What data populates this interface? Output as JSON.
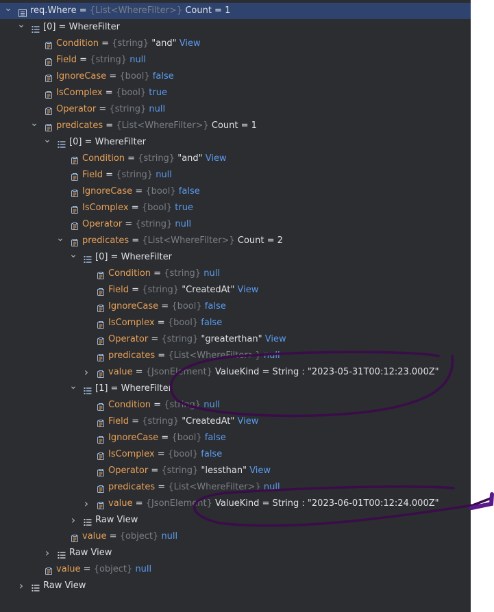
{
  "panel_bg": "#2b2d30",
  "annotation_color": "#3a0d4a",
  "rows": [
    {
      "depth": 0,
      "expander": "expanded",
      "icon": "list-icon",
      "name": "req.Where",
      "name_plain": true,
      "type": "{List<WhereFilter>}",
      "value": "Count = 1",
      "value_kind": "plain",
      "link": "",
      "selected": true
    },
    {
      "depth": 1,
      "expander": "expanded",
      "icon": "array-item-icon",
      "name": "[0]",
      "name_plain": true,
      "type": "",
      "value": "WhereFilter",
      "value_kind": "plain",
      "link": ""
    },
    {
      "depth": 2,
      "expander": "none",
      "icon": "property-icon",
      "name": "Condition",
      "type": "{string}",
      "value": "\"and\"",
      "value_kind": "str",
      "link": "View"
    },
    {
      "depth": 2,
      "expander": "none",
      "icon": "property-icon",
      "name": "Field",
      "type": "{string}",
      "value": "null",
      "value_kind": "kw",
      "link": ""
    },
    {
      "depth": 2,
      "expander": "none",
      "icon": "property-icon",
      "name": "IgnoreCase",
      "type": "{bool}",
      "value": "false",
      "value_kind": "kw",
      "link": ""
    },
    {
      "depth": 2,
      "expander": "none",
      "icon": "property-icon",
      "name": "IsComplex",
      "type": "{bool}",
      "value": "true",
      "value_kind": "kw",
      "link": ""
    },
    {
      "depth": 2,
      "expander": "none",
      "icon": "property-icon",
      "name": "Operator",
      "type": "{string}",
      "value": "null",
      "value_kind": "kw",
      "link": ""
    },
    {
      "depth": 2,
      "expander": "expanded",
      "icon": "property-icon",
      "name": "predicates",
      "type": "{List<WhereFilter>}",
      "value": "Count = 1",
      "value_kind": "plain",
      "link": ""
    },
    {
      "depth": 3,
      "expander": "expanded",
      "icon": "array-item-icon",
      "name": "[0]",
      "type": "",
      "value": "WhereFilter",
      "value_kind": "plain",
      "link": ""
    },
    {
      "depth": 4,
      "expander": "none",
      "icon": "property-icon",
      "name": "Condition",
      "type": "{string}",
      "value": "\"and\"",
      "value_kind": "str",
      "link": "View"
    },
    {
      "depth": 4,
      "expander": "none",
      "icon": "property-icon",
      "name": "Field",
      "type": "{string}",
      "value": "null",
      "value_kind": "kw",
      "link": ""
    },
    {
      "depth": 4,
      "expander": "none",
      "icon": "property-icon",
      "name": "IgnoreCase",
      "type": "{bool}",
      "value": "false",
      "value_kind": "kw",
      "link": ""
    },
    {
      "depth": 4,
      "expander": "none",
      "icon": "property-icon",
      "name": "IsComplex",
      "type": "{bool}",
      "value": "true",
      "value_kind": "kw",
      "link": ""
    },
    {
      "depth": 4,
      "expander": "none",
      "icon": "property-icon",
      "name": "Operator",
      "type": "{string}",
      "value": "null",
      "value_kind": "kw",
      "link": ""
    },
    {
      "depth": 4,
      "expander": "expanded",
      "icon": "property-icon",
      "name": "predicates",
      "type": "{List<WhereFilter>}",
      "value": "Count = 2",
      "value_kind": "plain",
      "link": ""
    },
    {
      "depth": 5,
      "expander": "expanded",
      "icon": "array-item-icon",
      "name": "[0]",
      "type": "",
      "value": "WhereFilter",
      "value_kind": "plain",
      "link": ""
    },
    {
      "depth": 6,
      "expander": "none",
      "icon": "property-icon",
      "name": "Condition",
      "type": "{string}",
      "value": "null",
      "value_kind": "kw",
      "link": ""
    },
    {
      "depth": 6,
      "expander": "none",
      "icon": "property-icon",
      "name": "Field",
      "type": "{string}",
      "value": "\"CreatedAt\"",
      "value_kind": "str",
      "link": "View"
    },
    {
      "depth": 6,
      "expander": "none",
      "icon": "property-icon",
      "name": "IgnoreCase",
      "type": "{bool}",
      "value": "false",
      "value_kind": "kw",
      "link": ""
    },
    {
      "depth": 6,
      "expander": "none",
      "icon": "property-icon",
      "name": "IsComplex",
      "type": "{bool}",
      "value": "false",
      "value_kind": "kw",
      "link": ""
    },
    {
      "depth": 6,
      "expander": "none",
      "icon": "property-icon",
      "name": "Operator",
      "type": "{string}",
      "value": "\"greaterthan\"",
      "value_kind": "str",
      "link": "View"
    },
    {
      "depth": 6,
      "expander": "none",
      "icon": "property-icon",
      "name": "predicates",
      "type": "{List<WhereFilter>}",
      "value": "null",
      "value_kind": "kw",
      "link": ""
    },
    {
      "depth": 6,
      "expander": "collapsed",
      "icon": "property-icon",
      "name": "value",
      "type": "{JsonElement}",
      "value": "ValueKind = String : \"2023-05-31T00:12:23.000Z\"",
      "value_kind": "plain",
      "link": ""
    },
    {
      "depth": 5,
      "expander": "expanded",
      "icon": "array-item-icon",
      "name": "[1]",
      "type": "",
      "value": "WhereFilter",
      "value_kind": "plain",
      "link": ""
    },
    {
      "depth": 6,
      "expander": "none",
      "icon": "property-icon",
      "name": "Condition",
      "type": "{string}",
      "value": "null",
      "value_kind": "kw",
      "link": ""
    },
    {
      "depth": 6,
      "expander": "none",
      "icon": "property-icon",
      "name": "Field",
      "type": "{string}",
      "value": "\"CreatedAt\"",
      "value_kind": "str",
      "link": "View"
    },
    {
      "depth": 6,
      "expander": "none",
      "icon": "property-icon",
      "name": "IgnoreCase",
      "type": "{bool}",
      "value": "false",
      "value_kind": "kw",
      "link": ""
    },
    {
      "depth": 6,
      "expander": "none",
      "icon": "property-icon",
      "name": "IsComplex",
      "type": "{bool}",
      "value": "false",
      "value_kind": "kw",
      "link": ""
    },
    {
      "depth": 6,
      "expander": "none",
      "icon": "property-icon",
      "name": "Operator",
      "type": "{string}",
      "value": "\"lessthan\"",
      "value_kind": "str",
      "link": "View"
    },
    {
      "depth": 6,
      "expander": "none",
      "icon": "property-icon",
      "name": "predicates",
      "type": "{List<WhereFilter>}",
      "value": "null",
      "value_kind": "kw",
      "link": ""
    },
    {
      "depth": 6,
      "expander": "collapsed",
      "icon": "property-icon",
      "name": "value",
      "type": "{JsonElement}",
      "value": "ValueKind = String : \"2023-06-01T00:12:24.000Z\"",
      "value_kind": "plain",
      "link": ""
    },
    {
      "depth": 5,
      "expander": "collapsed",
      "icon": "raw-view-icon",
      "name": "Raw View",
      "type": "",
      "value": "",
      "value_kind": "plain",
      "link": "",
      "raw": true
    },
    {
      "depth": 4,
      "expander": "none",
      "icon": "property-icon",
      "name": "value",
      "type": "{object}",
      "value": "null",
      "value_kind": "kw",
      "link": ""
    },
    {
      "depth": 3,
      "expander": "collapsed",
      "icon": "raw-view-icon",
      "name": "Raw View",
      "type": "",
      "value": "",
      "value_kind": "plain",
      "link": "",
      "raw": true
    },
    {
      "depth": 2,
      "expander": "none",
      "icon": "property-icon",
      "name": "value",
      "type": "{object}",
      "value": "null",
      "value_kind": "kw",
      "link": ""
    },
    {
      "depth": 1,
      "expander": "collapsed",
      "icon": "raw-view-icon",
      "name": "Raw View",
      "type": "",
      "value": "",
      "value_kind": "plain",
      "link": "",
      "raw": true
    }
  ]
}
